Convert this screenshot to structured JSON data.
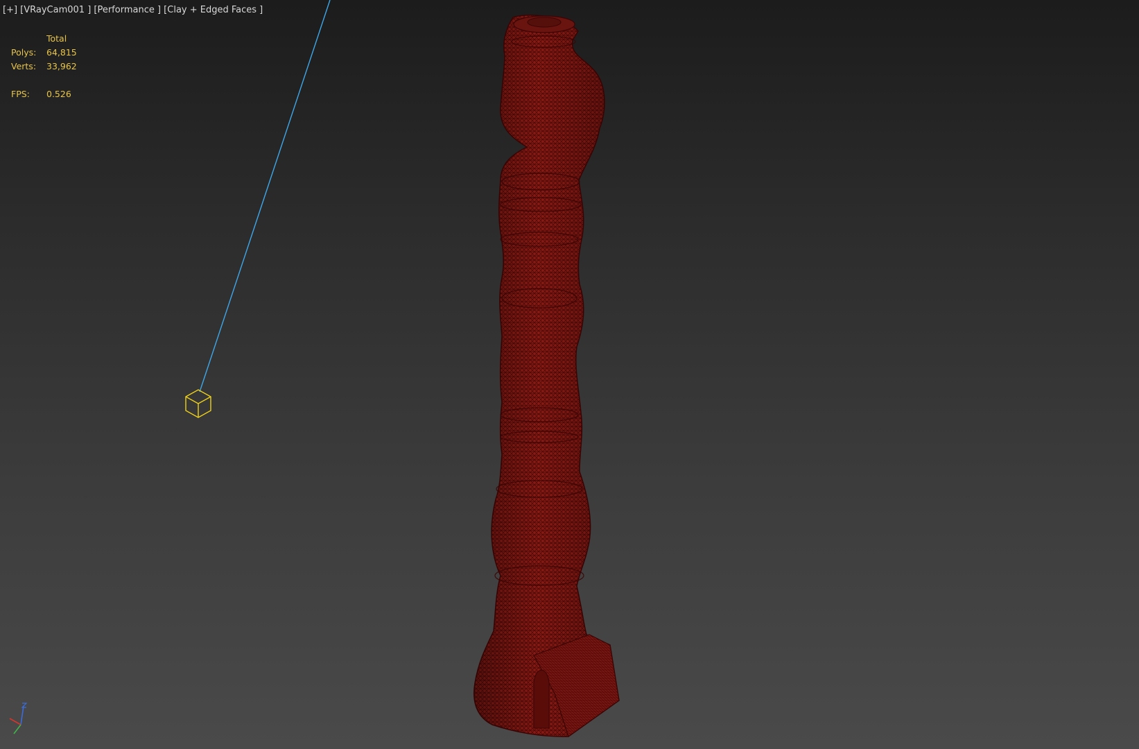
{
  "viewport": {
    "label": "[+] [VRayCam001 ] [Performance ] [Clay + Edged Faces ]",
    "stats": {
      "header": "Total",
      "polys_label": "Polys:",
      "polys_value": "64,815",
      "verts_label": "Verts:",
      "verts_value": "33,962",
      "fps_label": "FPS:",
      "fps_value": "0.526"
    },
    "colors": {
      "stats_text": "#e8c54a",
      "camera_line": "#3fa7e8",
      "camera_box": "#f0d21a",
      "mesh_fill": "#8a1a14",
      "mesh_wire": "#4a0806"
    },
    "icons": {
      "camera": "camera-target-cube-icon",
      "axis_gizmo": "xyz-axis-icon"
    }
  }
}
